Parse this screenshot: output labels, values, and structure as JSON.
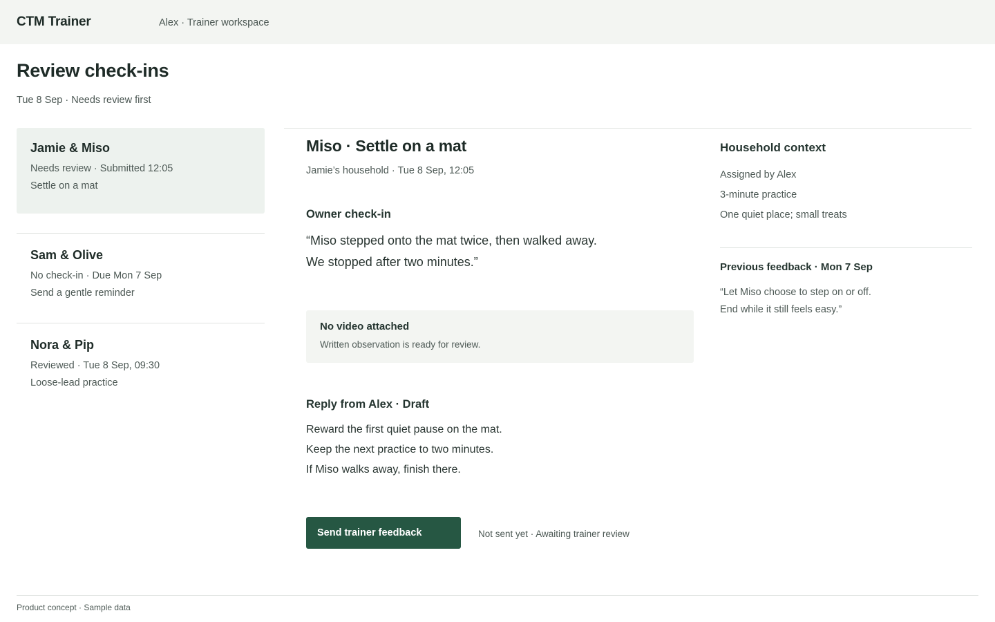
{
  "app": {
    "brand": "CTM Trainer",
    "workspace": "Alex · Trainer workspace"
  },
  "page": {
    "title": "Review check-ins",
    "subtitle": "Tue 8 Sep · Needs review first"
  },
  "queue": [
    {
      "name": "Jamie & Miso",
      "status": "Needs review · Submitted 12:05",
      "task": "Settle on a mat",
      "selected": true
    },
    {
      "name": "Sam & Olive",
      "status": "No check-in · Due Mon 7 Sep",
      "task": "Send a gentle reminder",
      "selected": false
    },
    {
      "name": "Nora & Pip",
      "status": "Reviewed · Tue 8 Sep, 09:30",
      "task": "Loose-lead practice",
      "selected": false
    }
  ],
  "detail": {
    "title": "Miso · Settle on a mat",
    "meta": "Jamie’s household · Tue 8 Sep, 12:05",
    "checkin_heading": "Owner check-in",
    "checkin_quote": [
      "“Miso stepped onto the mat twice, then walked away.",
      "We stopped after two minutes.”"
    ],
    "video": {
      "title": "No video attached",
      "note": "Written observation is ready for review."
    },
    "reply_heading": "Reply from Alex · Draft",
    "reply_lines": [
      "Reward the first quiet pause on the mat.",
      "Keep the next practice to two minutes.",
      "If Miso walks away, finish there."
    ],
    "send_label": "Send trainer feedback",
    "send_status": "Not sent yet · Awaiting trainer review"
  },
  "context": {
    "heading": "Household context",
    "lines": [
      "Assigned by Alex",
      "3-minute practice",
      "One quiet place; small treats"
    ],
    "previous_heading": "Previous feedback · Mon 7 Sep",
    "previous_lines": [
      "“Let Miso choose to step on or off.",
      "End while it still feels easy.”"
    ]
  },
  "footer": {
    "note": "Product concept · Sample data"
  }
}
